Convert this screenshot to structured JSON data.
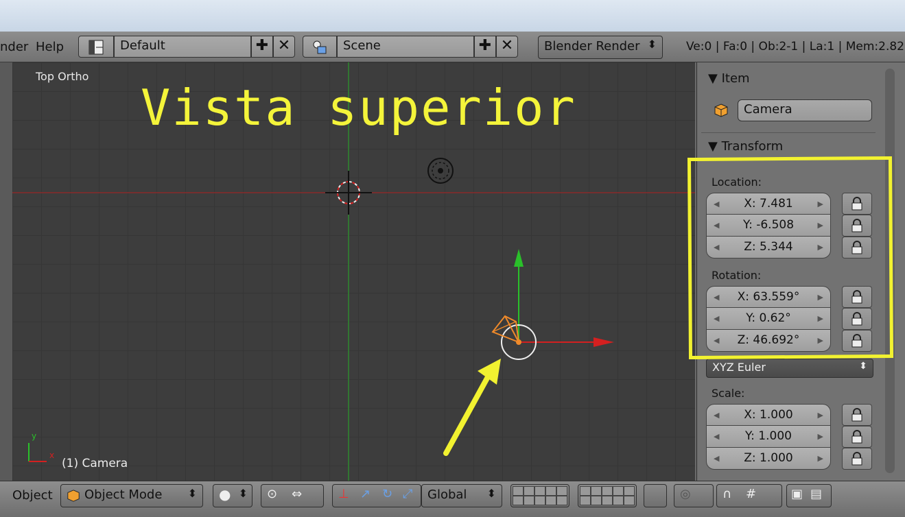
{
  "header": {
    "menu_partial": "nder",
    "help": "Help",
    "layout": "Default",
    "scene": "Scene",
    "engine": "Blender Render",
    "stats": "Ve:0 | Fa:0 | Ob:2-1 | La:1 | Mem:2.82M"
  },
  "viewport": {
    "view_name": "Top Ortho",
    "overlay_title": "Vista superior",
    "object_label": "(1) Camera",
    "axis_y": "y",
    "axis_x": "x"
  },
  "panel": {
    "item_title": "Item",
    "object_name": "Camera",
    "transform_title": "Transform",
    "location_label": "Location:",
    "location": [
      "X: 7.481",
      "Y: -6.508",
      "Z: 5.344"
    ],
    "rotation_label": "Rotation:",
    "rotation": [
      "X: 63.559°",
      "Y: 0.62°",
      "Z: 46.692°"
    ],
    "rotation_mode": "XYZ Euler",
    "scale_label": "Scale:",
    "scale": [
      "X: 1.000",
      "Y: 1.000",
      "Z: 1.000"
    ]
  },
  "footer": {
    "object_menu": "Object",
    "mode": "Object Mode",
    "orientation": "Global"
  },
  "colors": {
    "annotation": "#f2f230",
    "x_axis": "#d42020",
    "y_axis": "#20b020",
    "camera": "#f08a2a"
  }
}
